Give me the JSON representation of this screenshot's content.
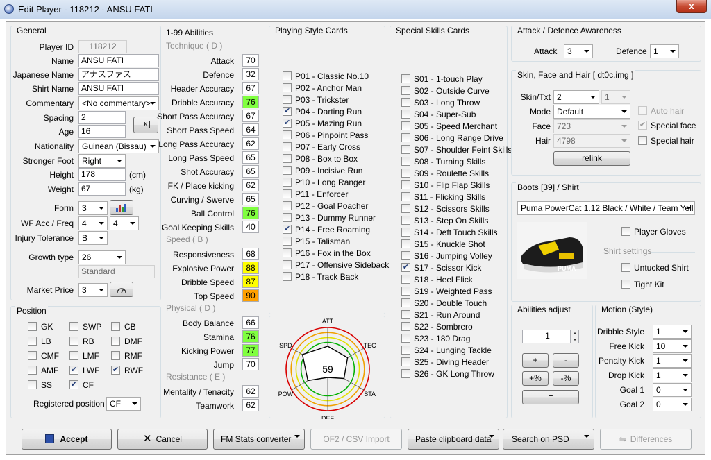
{
  "window": {
    "title": "Edit Player - 118212 - ANSU FATI",
    "close_glyph": "x"
  },
  "general": {
    "legend": "General",
    "player_id": {
      "label": "Player ID",
      "value": "118212"
    },
    "name": {
      "label": "Name",
      "value": "ANSU FATI"
    },
    "japanese_name": {
      "label": "Japanese Name",
      "value": "アナスファス"
    },
    "shirt_name": {
      "label": "Shirt Name",
      "value": "ANSU FATI"
    },
    "commentary": {
      "label": "Commentary",
      "value": "<No commentary>"
    },
    "spacing": {
      "label": "Spacing",
      "value": "2"
    },
    "age": {
      "label": "Age",
      "value": "16"
    },
    "nationality": {
      "label": "Nationality",
      "value": "Guinean (Bissau)"
    },
    "stronger_foot": {
      "label": "Stronger Foot",
      "value": "Right"
    },
    "height": {
      "label": "Height",
      "value": "178",
      "unit": "(cm)"
    },
    "weight": {
      "label": "Weight",
      "value": "67",
      "unit": "(kg)"
    },
    "form": {
      "label": "Form",
      "value": "3"
    },
    "wf": {
      "label": "WF Acc / Freq",
      "acc": "4",
      "freq": "4"
    },
    "injury": {
      "label": "Injury Tolerance",
      "value": "B"
    },
    "growth": {
      "label": "Growth type",
      "value": "26",
      "desc": "Standard"
    },
    "market_price": {
      "label": "Market Price",
      "value": "3"
    }
  },
  "position": {
    "legend": "Position",
    "items": [
      {
        "label": "GK",
        "checked": false
      },
      {
        "label": "SWP",
        "checked": false
      },
      {
        "label": "CB",
        "checked": false
      },
      {
        "label": "LB",
        "checked": false
      },
      {
        "label": "RB",
        "checked": false
      },
      {
        "label": "DMF",
        "checked": false
      },
      {
        "label": "CMF",
        "checked": false
      },
      {
        "label": "LMF",
        "checked": false
      },
      {
        "label": "RMF",
        "checked": false
      },
      {
        "label": "AMF",
        "checked": false
      },
      {
        "label": "LWF",
        "checked": true
      },
      {
        "label": "RWF",
        "checked": true
      },
      {
        "label": "SS",
        "checked": false
      },
      {
        "label": "CF",
        "checked": true
      }
    ],
    "registered": {
      "label": "Registered position",
      "value": "CF"
    }
  },
  "abilities": {
    "legend": "1-99 Abilities",
    "sections": [
      {
        "title": "Technique ( D )",
        "items": [
          {
            "label": "Attack",
            "value": "70",
            "color": "#ffffff"
          },
          {
            "label": "Defence",
            "value": "32",
            "color": "#ffffff"
          },
          {
            "label": "Header Accuracy",
            "value": "67",
            "color": "#ffffff"
          },
          {
            "label": "Dribble Accuracy",
            "value": "76",
            "color": "#80ff40"
          },
          {
            "label": "Short Pass Accuracy",
            "value": "67",
            "color": "#ffffff"
          },
          {
            "label": "Short Pass Speed",
            "value": "64",
            "color": "#ffffff"
          },
          {
            "label": "Long Pass Accuracy",
            "value": "62",
            "color": "#ffffff"
          },
          {
            "label": "Long Pass Speed",
            "value": "65",
            "color": "#ffffff"
          },
          {
            "label": "Shot Accuracy",
            "value": "65",
            "color": "#ffffff"
          },
          {
            "label": "FK / Place kicking",
            "value": "62",
            "color": "#ffffff"
          },
          {
            "label": "Curving / Swerve",
            "value": "65",
            "color": "#ffffff"
          },
          {
            "label": "Ball Control",
            "value": "76",
            "color": "#80ff40"
          },
          {
            "label": "Goal Keeping Skills",
            "value": "40",
            "color": "#ffffff"
          }
        ]
      },
      {
        "title": "Speed ( B )",
        "items": [
          {
            "label": "Responsiveness",
            "value": "68",
            "color": "#ffffff"
          },
          {
            "label": "Explosive Power",
            "value": "88",
            "color": "#ffff00"
          },
          {
            "label": "Dribble Speed",
            "value": "87",
            "color": "#ffff00"
          },
          {
            "label": "Top Speed",
            "value": "90",
            "color": "#ffa000"
          }
        ]
      },
      {
        "title": "Physical ( D )",
        "items": [
          {
            "label": "Body Balance",
            "value": "66",
            "color": "#ffffff"
          },
          {
            "label": "Stamina",
            "value": "76",
            "color": "#80ff40"
          },
          {
            "label": "Kicking Power",
            "value": "77",
            "color": "#80ff40"
          },
          {
            "label": "Jump",
            "value": "70",
            "color": "#ffffff"
          }
        ]
      },
      {
        "title": "Resistance ( E )",
        "items": [
          {
            "label": "Mentality / Tenacity",
            "value": "62",
            "color": "#ffffff"
          },
          {
            "label": "Teamwork",
            "value": "62",
            "color": "#ffffff"
          }
        ]
      }
    ]
  },
  "playing_styles": {
    "legend": "Playing Style Cards",
    "items": [
      {
        "label": "P01 - Classic No.10",
        "checked": false
      },
      {
        "label": "P02 - Anchor Man",
        "checked": false
      },
      {
        "label": "P03 - Trickster",
        "checked": false
      },
      {
        "label": "P04 - Darting Run",
        "checked": true
      },
      {
        "label": "P05 - Mazing Run",
        "checked": true
      },
      {
        "label": "P06 - Pinpoint Pass",
        "checked": false
      },
      {
        "label": "P07 - Early Cross",
        "checked": false
      },
      {
        "label": "P08 - Box to Box",
        "checked": false
      },
      {
        "label": "P09 - Incisive Run",
        "checked": false
      },
      {
        "label": "P10 - Long Ranger",
        "checked": false
      },
      {
        "label": "P11 - Enforcer",
        "checked": false
      },
      {
        "label": "P12 - Goal Poacher",
        "checked": false
      },
      {
        "label": "P13 - Dummy Runner",
        "checked": false
      },
      {
        "label": "P14 - Free Roaming",
        "checked": true
      },
      {
        "label": "P15 - Talisman",
        "checked": false
      },
      {
        "label": "P16 - Fox in the Box",
        "checked": false
      },
      {
        "label": "P17 - Offensive Sideback",
        "checked": false
      },
      {
        "label": "P18 - Track Back",
        "checked": false
      }
    ]
  },
  "special_skills": {
    "legend": "Special Skills Cards",
    "items": [
      {
        "label": "S01 - 1-touch Play",
        "checked": false
      },
      {
        "label": "S02 - Outside Curve",
        "checked": false
      },
      {
        "label": "S03 - Long Throw",
        "checked": false
      },
      {
        "label": "S04 - Super-Sub",
        "checked": false
      },
      {
        "label": "S05 - Speed Merchant",
        "checked": false
      },
      {
        "label": "S06 - Long Range Drive",
        "checked": false
      },
      {
        "label": "S07 - Shoulder Feint Skills",
        "checked": false
      },
      {
        "label": "S08 - Turning Skills",
        "checked": false
      },
      {
        "label": "S09 - Roulette Skills",
        "checked": false
      },
      {
        "label": "S10 - Flip Flap Skills",
        "checked": false
      },
      {
        "label": "S11 - Flicking Skills",
        "checked": false
      },
      {
        "label": "S12 - Scissors Skills",
        "checked": false
      },
      {
        "label": "S13 - Step On Skills",
        "checked": false
      },
      {
        "label": "S14 - Deft Touch Skills",
        "checked": false
      },
      {
        "label": "S15 - Knuckle Shot",
        "checked": false
      },
      {
        "label": "S16 - Jumping Volley",
        "checked": false
      },
      {
        "label": "S17 - Scissor Kick",
        "checked": true
      },
      {
        "label": "S18 - Heel Flick",
        "checked": false
      },
      {
        "label": "S19 - Weighted Pass",
        "checked": false
      },
      {
        "label": "S20 - Double Touch",
        "checked": false
      },
      {
        "label": "S21 - Run Around",
        "checked": false
      },
      {
        "label": "S22 - Sombrero",
        "checked": false
      },
      {
        "label": "S23 - 180 Drag",
        "checked": false
      },
      {
        "label": "S24 - Lunging Tackle",
        "checked": false
      },
      {
        "label": "S25 - Diving Header",
        "checked": false
      },
      {
        "label": "S26 - GK Long Throw",
        "checked": false
      }
    ]
  },
  "radar": {
    "center_value": "59",
    "axes": [
      {
        "label": "ATT",
        "value": 0.55
      },
      {
        "label": "TEC",
        "value": 0.55
      },
      {
        "label": "STA",
        "value": 0.45
      },
      {
        "label": "DEF",
        "value": 0.2
      },
      {
        "label": "POW",
        "value": 0.55
      },
      {
        "label": "SPD",
        "value": 0.7
      }
    ],
    "ring_colors": [
      "#d80000",
      "#f0a000",
      "#e0e000",
      "#00b000"
    ]
  },
  "awareness": {
    "legend": "Attack / Defence Awareness",
    "attack": {
      "label": "Attack",
      "value": "3"
    },
    "defence": {
      "label": "Defence",
      "value": "1"
    }
  },
  "skin": {
    "legend": "Skin, Face and Hair [ dt0c.img ]",
    "skin_txt": {
      "label": "Skin/Txt",
      "value1": "2",
      "value2": "1"
    },
    "mode": {
      "label": "Mode",
      "value": "Default"
    },
    "face": {
      "label": "Face",
      "value": "723"
    },
    "hair": {
      "label": "Hair",
      "value": "4798"
    },
    "auto_hair": {
      "label": "Auto hair",
      "checked": false
    },
    "special_face": {
      "label": "Special face",
      "checked": true
    },
    "special_hair": {
      "label": "Special hair",
      "checked": false
    },
    "relink": "relink"
  },
  "boots": {
    "legend": "Boots [39] / Shirt",
    "value": "Puma PowerCat 1.12 Black / White / Team Yello",
    "player_gloves": {
      "label": "Player Gloves",
      "checked": false
    },
    "shirt_settings": "Shirt settings",
    "untucked": {
      "label": "Untucked Shirt",
      "checked": false
    },
    "tight_kit": {
      "label": "Tight Kit",
      "checked": false
    },
    "brand": "PUMA"
  },
  "abilities_adjust": {
    "legend": "Abilities adjust",
    "value": "1",
    "plus": "+",
    "minus": "-",
    "plus_pct": "+%",
    "minus_pct": "-%",
    "equals": "="
  },
  "motion": {
    "legend": "Motion (Style)",
    "items": [
      {
        "label": "Dribble Style",
        "value": "1"
      },
      {
        "label": "Free Kick",
        "value": "10"
      },
      {
        "label": "Penalty Kick",
        "value": "1"
      },
      {
        "label": "Drop Kick",
        "value": "1"
      },
      {
        "label": "Goal 1",
        "value": "0"
      },
      {
        "label": "Goal 2",
        "value": "0"
      }
    ]
  },
  "footer": {
    "accept": "Accept",
    "cancel": "Cancel",
    "fm_stats": "FM Stats converter",
    "of2_csv": "OF2 / CSV Import",
    "paste": "Paste clipboard data",
    "search_psd": "Search on PSD",
    "differences": "Differences"
  }
}
